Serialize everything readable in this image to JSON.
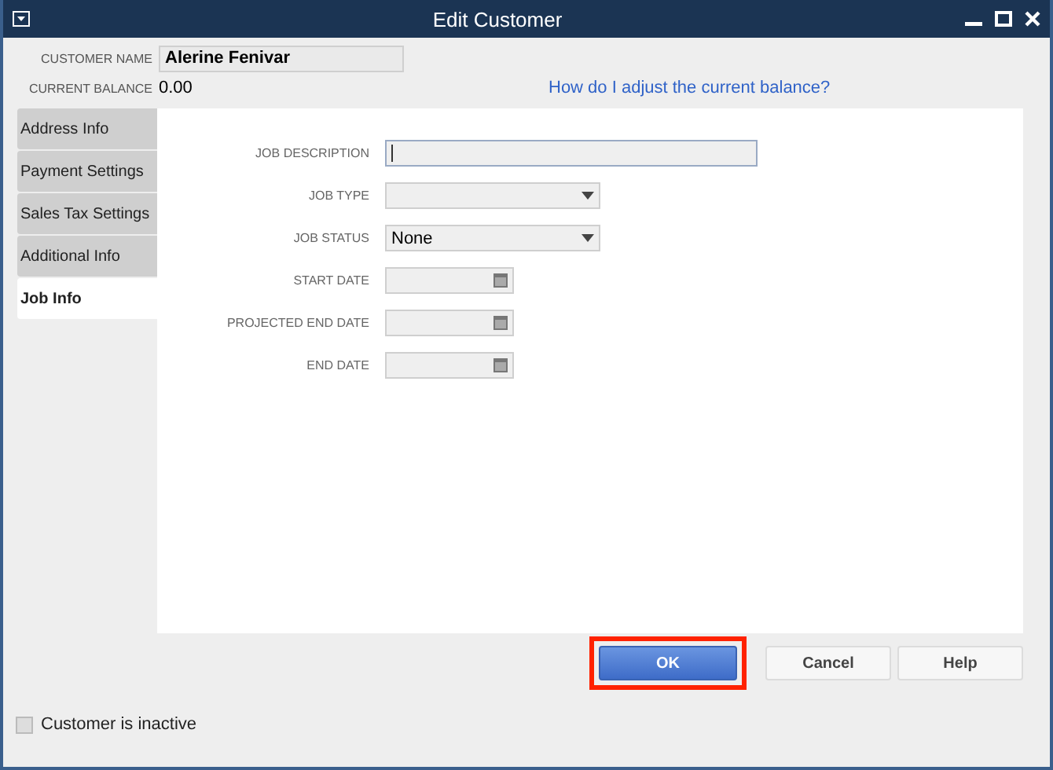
{
  "window": {
    "title": "Edit Customer"
  },
  "customer_name": {
    "label": "CUSTOMER NAME",
    "value": "Alerine Fenivar"
  },
  "current_balance": {
    "label": "CURRENT BALANCE",
    "value": "0.00"
  },
  "help_link": "How do I adjust the current balance?",
  "tabs": [
    {
      "label": "Address Info",
      "selected": false
    },
    {
      "label": "Payment Settings",
      "selected": false
    },
    {
      "label": "Sales Tax Settings",
      "selected": false
    },
    {
      "label": "Additional Info",
      "selected": false
    },
    {
      "label": "Job Info",
      "selected": true
    }
  ],
  "fields": [
    {
      "label": "JOB DESCRIPTION",
      "kind": "text",
      "focused": true
    },
    {
      "label": "JOB TYPE",
      "kind": "dropdown"
    },
    {
      "label": "JOB STATUS",
      "kind": "dropdown",
      "value": "None"
    },
    {
      "label": "START DATE",
      "kind": "date"
    },
    {
      "label": "PROJECTED END DATE",
      "kind": "date"
    },
    {
      "label": "END DATE",
      "kind": "date"
    }
  ],
  "buttons": [
    {
      "label": "OK",
      "primary": true,
      "highlighted": true
    },
    {
      "label": "Cancel",
      "primary": false,
      "highlighted": false
    },
    {
      "label": "Help",
      "primary": false,
      "highlighted": false
    }
  ],
  "inactive_checkbox": {
    "label": "Customer is inactive",
    "checked": false
  }
}
